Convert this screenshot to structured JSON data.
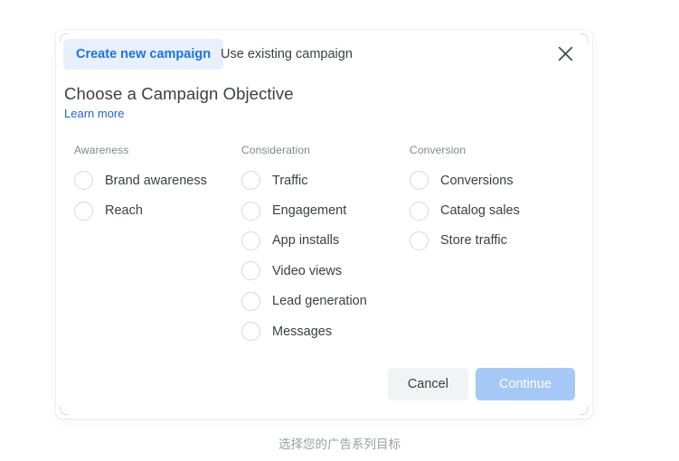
{
  "dialog": {
    "tabs": [
      {
        "label": "Create new campaign",
        "active": true
      },
      {
        "label": "Use existing campaign",
        "active": false
      }
    ],
    "close_icon": "close-icon",
    "heading": "Choose a Campaign Objective",
    "learn_more": "Learn more",
    "columns": [
      {
        "header": "Awareness",
        "options": [
          {
            "label": "Brand awareness",
            "selected": false
          },
          {
            "label": "Reach",
            "selected": false
          }
        ]
      },
      {
        "header": "Consideration",
        "options": [
          {
            "label": "Traffic",
            "selected": false
          },
          {
            "label": "Engagement",
            "selected": false
          },
          {
            "label": "App installs",
            "selected": false
          },
          {
            "label": "Video views",
            "selected": false
          },
          {
            "label": "Lead generation",
            "selected": false
          },
          {
            "label": "Messages",
            "selected": false
          }
        ]
      },
      {
        "header": "Conversion",
        "options": [
          {
            "label": "Conversions",
            "selected": false
          },
          {
            "label": "Catalog sales",
            "selected": false
          },
          {
            "label": "Store traffic",
            "selected": false
          }
        ]
      }
    ],
    "footer": {
      "cancel_label": "Cancel",
      "continue_label": "Continue"
    }
  },
  "caption": "选择您的广告系列目标",
  "colors": {
    "accent_blue": "#1a73e8",
    "tab_active_bg": "#e8f0fe",
    "link_blue": "#1967d2",
    "primary_button_bg": "#a6c8f6",
    "secondary_button_bg": "#f1f3f4",
    "text_primary": "#3c4043",
    "text_muted": "#80868b",
    "radio_border": "#d5d7da"
  }
}
